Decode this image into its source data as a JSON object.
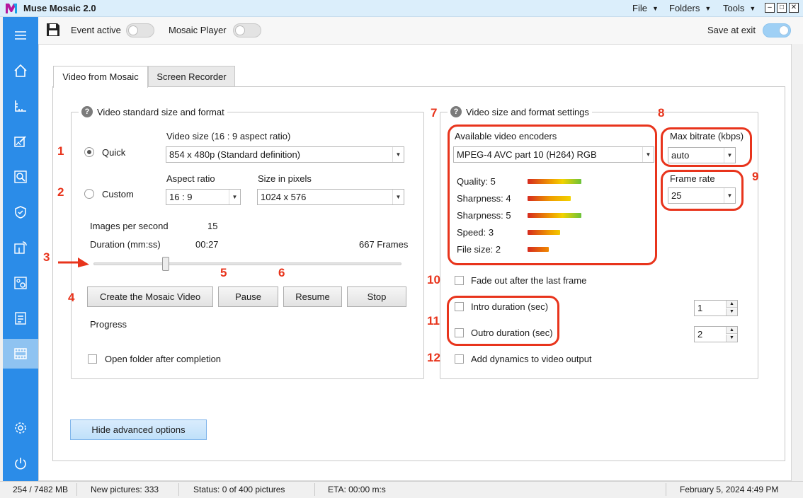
{
  "app": {
    "title": "Muse Mosaic 2.0",
    "menus": [
      "File",
      "Folders",
      "Tools"
    ],
    "accent": "#2b8ce8",
    "annotation_color": "#e8341c"
  },
  "toolbar": {
    "event_active_label": "Event active",
    "event_active_on": false,
    "mosaic_player_label": "Mosaic Player",
    "mosaic_player_on": false,
    "save_at_exit_label": "Save at exit",
    "save_at_exit_on": true
  },
  "sidebar": {
    "items": [
      "menu-icon",
      "home-icon",
      "ruler-icon",
      "edit-image-icon",
      "search-image-icon",
      "shield-icon",
      "touch-screen-icon",
      "image-settings-icon",
      "checklist-icon",
      "video-icon",
      "gear-icon",
      "power-icon"
    ],
    "active": "video-icon"
  },
  "tabs": [
    {
      "label": "Video from Mosaic",
      "active": true
    },
    {
      "label": "Screen Recorder",
      "active": false
    }
  ],
  "left_group": {
    "title": "Video standard size and format",
    "video_size_label": "Video size (16 : 9 aspect ratio)",
    "quick_label": "Quick",
    "quick_checked": true,
    "video_size_value": "854 x 480p (Standard definition)",
    "aspect_ratio_label": "Aspect ratio",
    "size_in_pixels_label": "Size in pixels",
    "custom_label": "Custom",
    "aspect_ratio_value": "16 : 9",
    "size_in_pixels_value": "1024 x 576",
    "images_per_second_label": "Images per second",
    "images_per_second_value": "15",
    "duration_label": "Duration (mm:ss)",
    "duration_value": "00:27",
    "frames_value": "667 Frames",
    "slider_fraction": 0.23,
    "create_button": "Create the Mosaic Video",
    "pause_button": "Pause",
    "resume_button": "Resume",
    "stop_button": "Stop",
    "progress_label": "Progress",
    "open_folder_label": "Open folder after completion"
  },
  "right_group": {
    "title": "Video size and format settings",
    "encoders_label": "Available video encoders",
    "encoder_value": "MPEG-4 AVC part 10 (H264) RGB",
    "ratings": [
      {
        "label": "Quality: 5",
        "value": 5
      },
      {
        "label": "Sharpness: 4",
        "value": 4
      },
      {
        "label": "Sharpness: 5",
        "value": 5
      },
      {
        "label": "Speed: 3",
        "value": 3
      },
      {
        "label": "File size: 2",
        "value": 2
      }
    ],
    "max_bitrate_label": "Max bitrate (kbps)",
    "max_bitrate_value": "auto",
    "frame_rate_label": "Frame rate",
    "frame_rate_value": "25",
    "fade_out_label": "Fade out after the last frame",
    "intro_label": "Intro duration (sec)",
    "intro_value": "1",
    "outro_label": "Outro duration (sec)",
    "outro_value": "2",
    "dynamics_label": "Add dynamics to video output"
  },
  "annotations": [
    "1",
    "2",
    "3",
    "4",
    "5",
    "6",
    "7",
    "8",
    "9",
    "10",
    "11",
    "12"
  ],
  "hide_advanced_button": "Hide advanced options",
  "status": {
    "memory": "254 / 7482 MB",
    "new_pictures": "New pictures: 333",
    "status": "Status: 0 of 400 pictures",
    "eta": "ETA: 00:00 m:s",
    "datetime": "February 5, 2024  4:49 PM"
  }
}
